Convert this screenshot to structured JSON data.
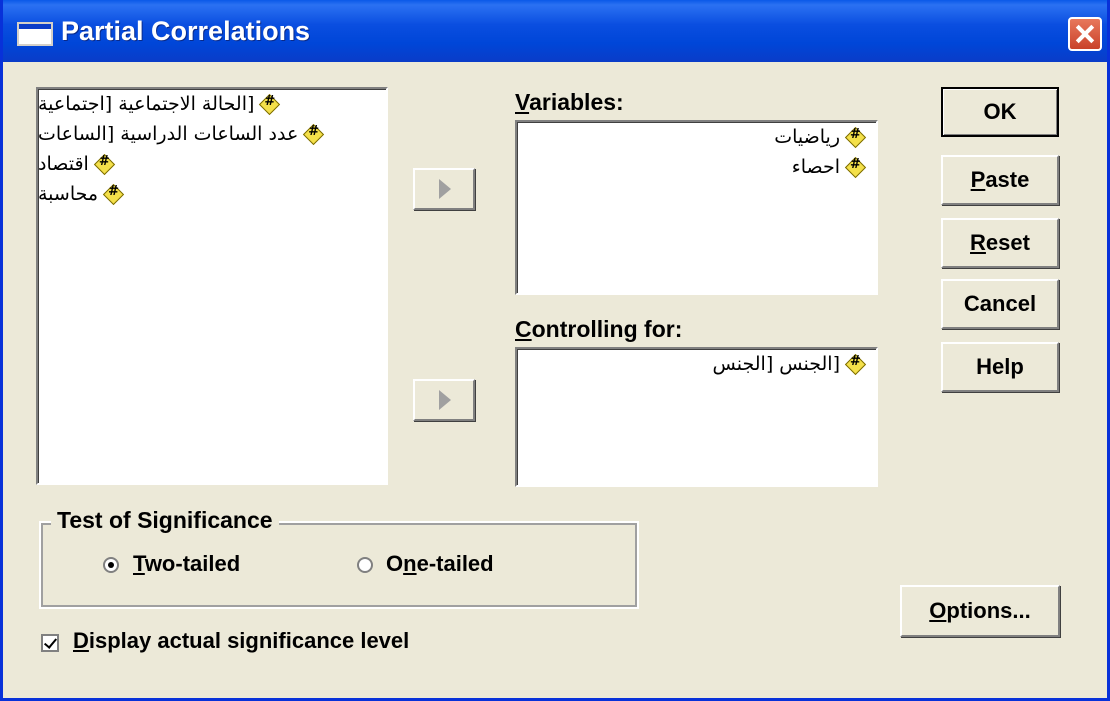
{
  "window": {
    "title": "Partial Correlations"
  },
  "source_list": {
    "items": [
      "[الحالة الاجتماعية [اجتماعية",
      "عدد الساعات الدراسية [الساعات",
      "اقتصاد",
      "محاسبة"
    ]
  },
  "variables": {
    "label": "Variables:",
    "label_mnemonic": "V",
    "label_rest": "ariables:",
    "items": [
      "رياضيات",
      "احصاء"
    ]
  },
  "controlling": {
    "label": "Controlling for:",
    "label_mnemonic": "C",
    "label_rest": "ontrolling for:",
    "items": [
      "[الجنس [الجنس"
    ]
  },
  "buttons": {
    "ok": "OK",
    "paste": "Paste",
    "paste_mnemonic": "P",
    "paste_rest": "aste",
    "reset": "Reset",
    "reset_mnemonic": "R",
    "reset_rest": "eset",
    "cancel": "Cancel",
    "help": "Help",
    "options": "Options...",
    "options_mnemonic": "O",
    "options_rest": "ptions..."
  },
  "significance": {
    "title": "Test of Significance",
    "two_tailed": "Two-tailed",
    "two_mnemonic": "T",
    "two_rest": "wo-tailed",
    "one_tailed": "One-tailed",
    "one_pre": "O",
    "one_mnemonic": "n",
    "one_rest": "e-tailed",
    "selected": "two-tailed"
  },
  "display_actual": {
    "label": "Display actual significance level",
    "mnemonic": "D",
    "rest": "isplay actual significance level",
    "checked": true
  },
  "icons": {
    "variable": "numeric-variable-icon",
    "move": "right-arrow-icon",
    "close": "close-icon"
  },
  "colors": {
    "titlebar": "#0a4ee0",
    "dialog_bg": "#ece9d8",
    "close_button": "#c9422a"
  }
}
